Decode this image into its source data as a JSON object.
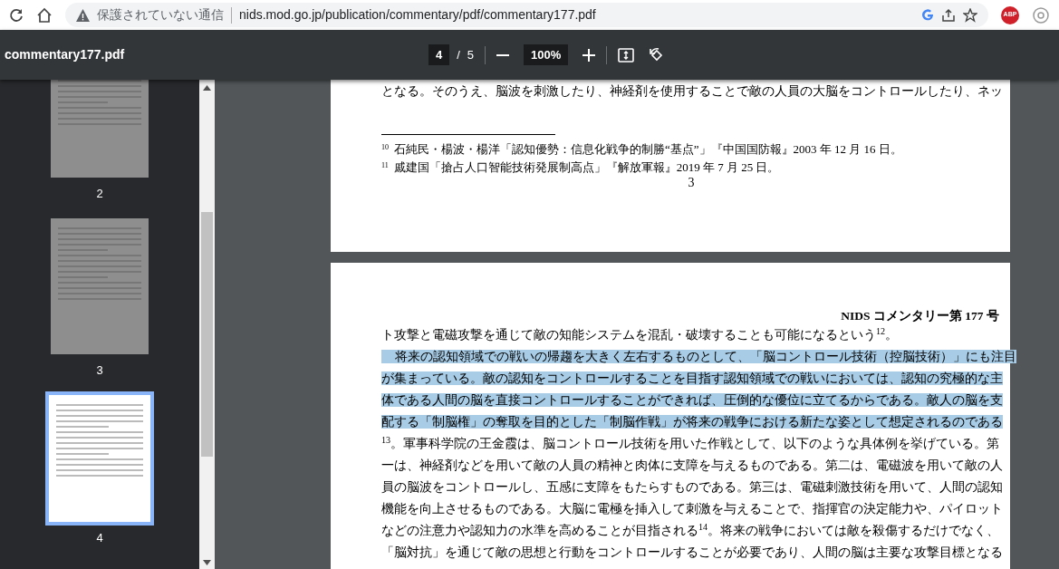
{
  "browser": {
    "security_label": "保護されていない通信",
    "url": "nids.mod.go.jp/publication/commentary/pdf/commentary177.pdf",
    "extension_badge": "ABP"
  },
  "pdf_toolbar": {
    "title": "commentary177.pdf",
    "current_page": "4",
    "separator": "/",
    "total_pages": "5",
    "zoom": "100%"
  },
  "thumbnails": [
    {
      "label": "2",
      "selected": false
    },
    {
      "label": "3",
      "selected": false
    },
    {
      "label": "4",
      "selected": true
    }
  ],
  "page_3": {
    "cut_line": "となる。そのうえ、脳波を刺激したり、神経剤を使用することで敵の人員の大脳をコントロールしたり、ネッ",
    "footnotes": [
      {
        "number": "10",
        "text": "石純民・楊波・楊洋「認知優勢：信息化戦争的制勝“基点”」『中国国防報』2003 年 12 月 16 日。"
      },
      {
        "number": "11",
        "text": "戚建国「搶占人口智能技術発展制高点」『解放軍報』2019 年 7 月 25 日。"
      }
    ],
    "page_number": "3"
  },
  "page_4": {
    "header": "NIDS コメンタリー第 177 号",
    "lines": [
      {
        "text": "ト攻撃と電磁攻撃を通じて敵の知能システムを混乱・破壊することも可能になるという$^{12}$。",
        "indent": false,
        "highlighted": false
      },
      {
        "text": "将来の認知領域での戦いの帰趨を大きく左右するものとして、「脳コントロール技術（控脳技術）」にも注目",
        "indent": true,
        "highlighted": true
      },
      {
        "text": "が集まっている。敵の認知をコントロールすることを目指す認知領域での戦いにおいては、認知の究極的な主",
        "indent": false,
        "highlighted": true
      },
      {
        "text": "体である人間の脳を直接コントロールすることができれば、圧倒的な優位に立てるからである。敵人の脳を支",
        "indent": false,
        "highlighted": true
      },
      {
        "text": "配する「制脳権」の奪取を目的とした「制脳作戦」が将来の戦争における新たな姿として想定されるのである",
        "indent": false,
        "highlighted": true
      },
      {
        "text": "$^{13}$。軍事科学院の王金霞は、脳コントロール技術を用いた作戦として、以下のような具体例を挙げている。第",
        "indent": false,
        "highlighted": false
      },
      {
        "text": "一は、神経剤などを用いて敵の人員の精神と肉体に支障を与えるものである。第二は、電磁波を用いて敵の人",
        "indent": false,
        "highlighted": false
      },
      {
        "text": "員の脳波をコントロールし、五感に支障をもたらすものである。第三は、電磁刺激技術を用いて、人間の認知",
        "indent": false,
        "highlighted": false
      },
      {
        "text": "機能を向上させるものである。大脳に電極を挿入して刺激を与えることで、指揮官の決定能力や、パイロット",
        "indent": false,
        "highlighted": false
      },
      {
        "text": "などの注意力や認知力の水準を高めることが目指される$^{14}$。将来の戦争においては敵を殺傷するだけでなく、",
        "indent": false,
        "highlighted": false
      },
      {
        "text": "「脳対抗」を通じて敵の思想と行動をコントロールすることが必要であり、人間の脳は主要な攻撃目標となる",
        "indent": false,
        "highlighted": false
      }
    ]
  }
}
